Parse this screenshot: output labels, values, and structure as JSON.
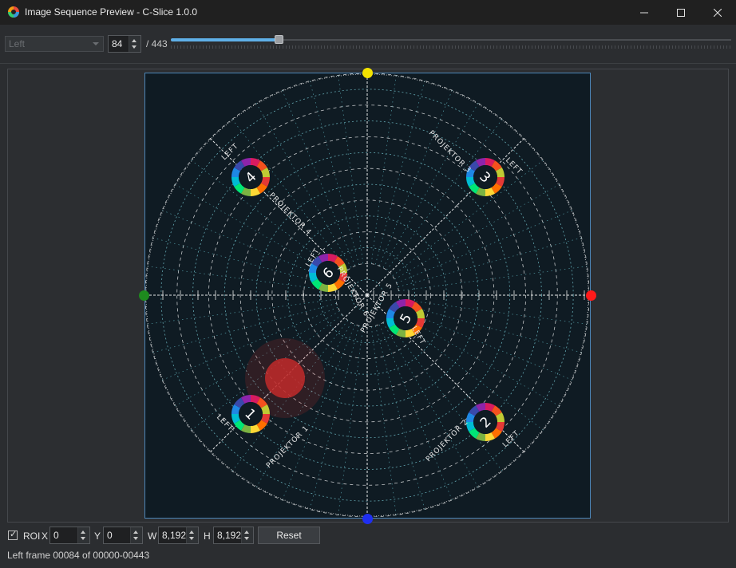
{
  "window": {
    "title": "Image Sequence Preview - C-Slice 1.0.0",
    "controls": [
      "minimize-icon",
      "maximize-icon",
      "close-icon"
    ]
  },
  "toolbar": {
    "view_select": {
      "value": "Left",
      "enabled": false
    },
    "frame_spin": {
      "value": "84"
    },
    "frame_total": "/ 443",
    "frame_slider": {
      "position": 84,
      "max": 443,
      "accent": "#5fb0e8"
    }
  },
  "preview": {
    "projector_labels": [
      "PROJEKTOR 1",
      "PROJEKTOR 2",
      "PROJEKTOR 3",
      "PROJEKTOR 4",
      "PROJEKTOR 5",
      "PROJEKTOR 6"
    ],
    "view_label": "LEFT",
    "numbers": [
      "1",
      "2",
      "3",
      "4",
      "5",
      "6"
    ],
    "handle_colors": {
      "top": "#f2e200",
      "left": "#1e8a1e",
      "right": "#ff1a1a",
      "bottom": "#1f2ff0"
    }
  },
  "roi": {
    "checkbox_checked": true,
    "label": "ROI",
    "x_label": "X",
    "x_value": "0",
    "y_label": "Y",
    "y_value": "0",
    "w_label": "W",
    "w_value": "8,192",
    "h_label": "H",
    "h_value": "8,192",
    "reset_label": "Reset"
  },
  "status": "Left frame 00084 of 00000-00443"
}
